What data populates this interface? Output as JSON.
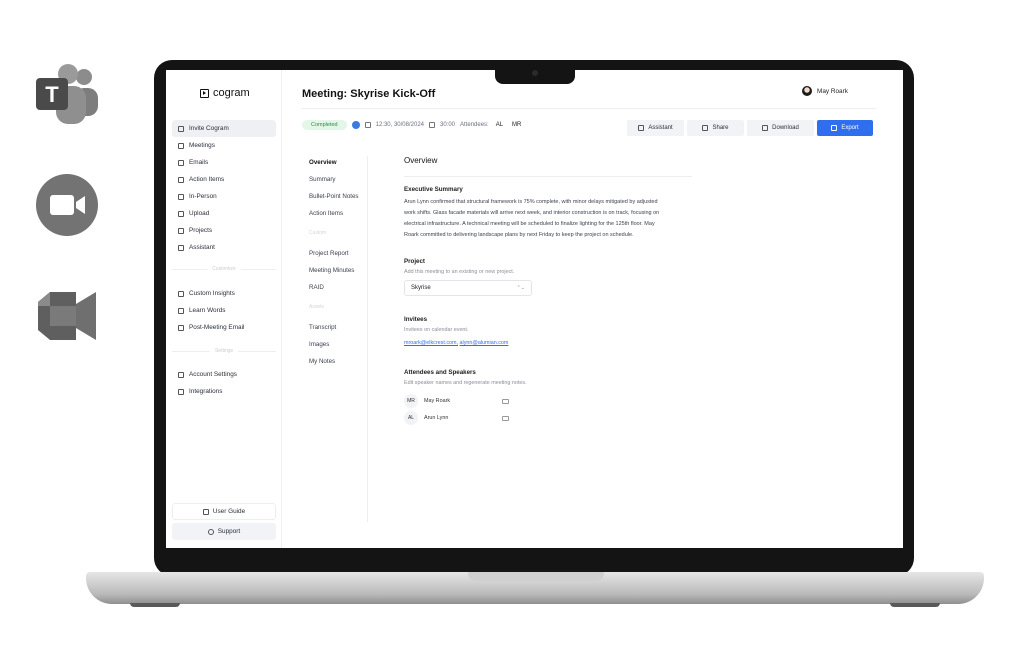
{
  "integrations": {
    "teams": "teams-icon",
    "zoom": "zoom-icon",
    "meet": "google-meet-icon"
  },
  "brand": {
    "name": "cogram"
  },
  "sidebar": {
    "items": [
      {
        "label": "Invite Cogram",
        "icon": "invite-icon"
      },
      {
        "label": "Meetings",
        "icon": "meetings-icon"
      },
      {
        "label": "Emails",
        "icon": "mail-icon"
      },
      {
        "label": "Action Items",
        "icon": "checklist-icon"
      },
      {
        "label": "In-Person",
        "icon": "mic-icon"
      },
      {
        "label": "Upload",
        "icon": "upload-icon"
      },
      {
        "label": "Projects",
        "icon": "folder-icon"
      },
      {
        "label": "Assistant",
        "icon": "assistant-icon"
      }
    ],
    "customize_label": "Customize",
    "custom_items": [
      {
        "label": "Custom Insights",
        "icon": "insight-icon"
      },
      {
        "label": "Learn Words",
        "icon": "book-icon"
      },
      {
        "label": "Post-Meeting Email",
        "icon": "mail-icon"
      }
    ],
    "settings_label": "Settings",
    "settings_items": [
      {
        "label": "Account Settings",
        "icon": "gear-icon"
      },
      {
        "label": "Integrations",
        "icon": "plug-icon"
      }
    ],
    "user_guide": "User Guide",
    "support": "Support"
  },
  "header": {
    "title": "Meeting: Skyrise Kick-Off",
    "user_name": "May Roark"
  },
  "meta": {
    "status": "Completed",
    "datetime": "12:30, 30/08/2024",
    "duration": "30:00",
    "attendees_label": "Attendees:",
    "attendees": [
      "AL",
      "MR"
    ]
  },
  "toolbar": {
    "assistant": "Assistant",
    "share": "Share",
    "download": "Download",
    "export": "Export"
  },
  "subnav": {
    "items": [
      "Overview",
      "Summary",
      "Bullet-Point Notes",
      "Action Items"
    ],
    "group_custom": "Custom",
    "custom_items": [
      "Project Report",
      "Meeting Minutes",
      "RAID"
    ],
    "group_assets": "Assets",
    "asset_items": [
      "Transcript",
      "Images",
      "My Notes"
    ]
  },
  "overview": {
    "heading": "Overview",
    "exec_title": "Executive Summary",
    "exec_lines": [
      "Arun Lynn confirmed that structural framework is 75% complete, with minor delays mitigated by adjusted",
      "work shifts. Glass facade materials will arrive next week, and interior construction is on track, focusing on",
      "electrical infrastructure. A technical meeting will be scheduled to finalize lighting for the 125th floor. May",
      "Roark committed to delivering landscape plans by next Friday to keep the project on schedule."
    ],
    "project_title": "Project",
    "project_hint": "Add this meeting to an existing or new project.",
    "project_value": "Skyrise",
    "invitees_title": "Invitees",
    "invitees_hint": "Invitees on calendar event.",
    "invitees": [
      "mroark@elkcrest.com,",
      "alynn@alumian.com"
    ],
    "speakers_title": "Attendees and Speakers",
    "speakers_hint": "Edit speaker names and regenerate meeting notes.",
    "speakers": [
      {
        "initials": "MR",
        "name": "May Roark"
      },
      {
        "initials": "AL",
        "name": "Arun Lynn"
      }
    ]
  }
}
